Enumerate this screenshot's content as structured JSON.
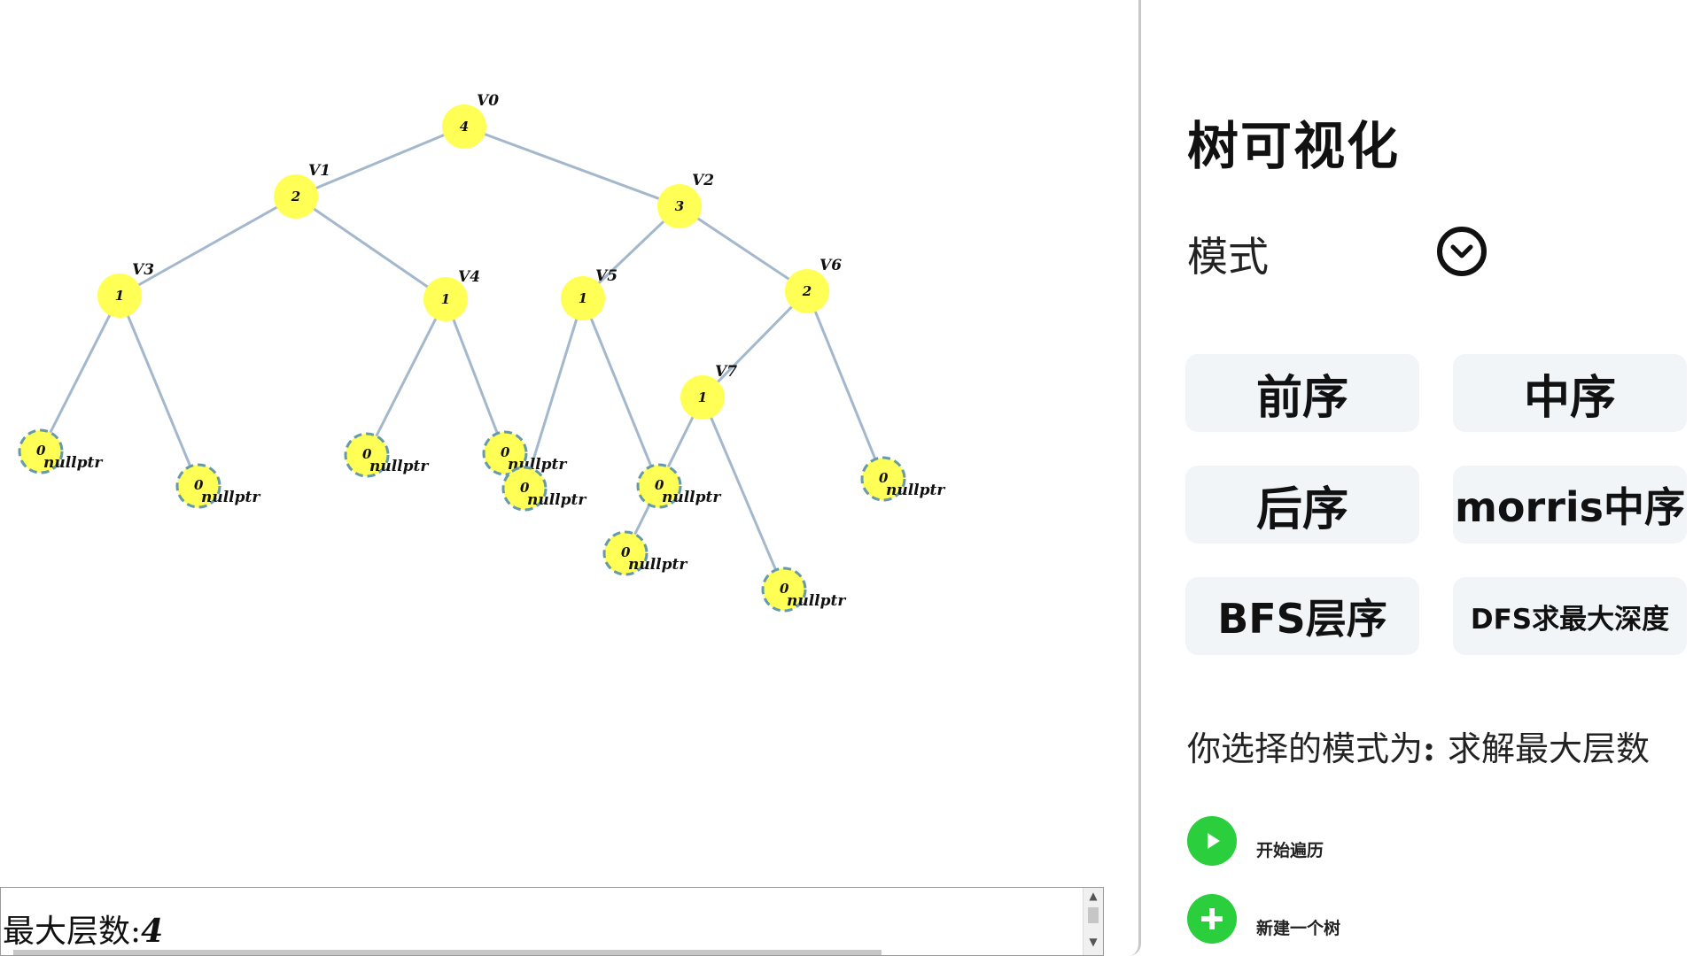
{
  "tree": {
    "nodes": [
      {
        "id": "V0",
        "label": "V0",
        "value": "4"
      },
      {
        "id": "V1",
        "label": "V1",
        "value": "2"
      },
      {
        "id": "V2",
        "label": "V2",
        "value": "3"
      },
      {
        "id": "V3",
        "label": "V3",
        "value": "1"
      },
      {
        "id": "V4",
        "label": "V4",
        "value": "1"
      },
      {
        "id": "V5",
        "label": "V5",
        "value": "1"
      },
      {
        "id": "V6",
        "label": "V6",
        "value": "2"
      },
      {
        "id": "V7",
        "label": "V7",
        "value": "1"
      }
    ],
    "null_nodes": [
      {
        "parent": "V3",
        "value": "0",
        "label": "nullptr"
      },
      {
        "parent": "V3",
        "value": "0",
        "label": "nullptr"
      },
      {
        "parent": "V4",
        "value": "0",
        "label": "nullptr"
      },
      {
        "parent": "V4",
        "value": "0",
        "label": "nullptr"
      },
      {
        "parent": "V5",
        "value": "0",
        "label": "nullptr"
      },
      {
        "parent": "V5",
        "value": "0",
        "label": "nullptr"
      },
      {
        "parent": "V7",
        "value": "0",
        "label": "nullptr"
      },
      {
        "parent": "V7",
        "value": "0",
        "label": "nullptr"
      },
      {
        "parent": "V6",
        "value": "0",
        "label": "nullptr"
      }
    ],
    "edges": [
      [
        "V0",
        "V1"
      ],
      [
        "V0",
        "V2"
      ],
      [
        "V1",
        "V3"
      ],
      [
        "V1",
        "V4"
      ],
      [
        "V2",
        "V5"
      ],
      [
        "V2",
        "V6"
      ],
      [
        "V6",
        "V7"
      ]
    ],
    "colors": {
      "node": "#ffff55",
      "edge": "#a3b8cc",
      "null_border": "#6699aa"
    }
  },
  "output": {
    "label": "最大层数:",
    "value": "4"
  },
  "side": {
    "title": "树可视化",
    "mode_label": "模式",
    "mode_dropdown_icon": "chevron-down-circle-icon",
    "buttons": [
      {
        "label": "前序"
      },
      {
        "label": "中序"
      },
      {
        "label": "后序"
      },
      {
        "label": "morris中序"
      },
      {
        "label": "BFS层序"
      },
      {
        "label": "DFS求最大深度"
      }
    ],
    "selected_mode_prefix": "你选择的模式为",
    "selected_mode_colon": ":",
    "selected_mode_value": "求解最大层数",
    "start_label": "开始遍历",
    "start_icon": "play-icon",
    "new_tree_label": "新建一个树",
    "new_tree_icon": "plus-icon",
    "action_color": "#2bce3c"
  }
}
